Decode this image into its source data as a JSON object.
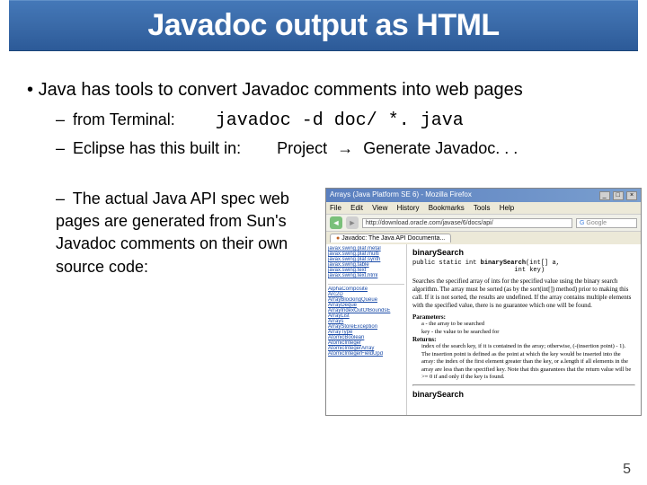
{
  "title": "Javadoc output as HTML",
  "bullet": "Java has tools to convert Javadoc comments into web pages",
  "sub1_label": "from Terminal:",
  "sub1_cmd": "javadoc -d doc/ *. java",
  "sub2_label": "Eclipse has this built in:",
  "sub2_menu1": "Project",
  "sub2_menu2": "Generate Javadoc. . .",
  "sub3_text": "The actual Java API spec web pages are generated from Sun's Javadoc comments on their own source code:",
  "page_num": "5",
  "browser": {
    "window_title": "Arrays (Java Platform SE 6) - Mozilla Firefox",
    "menu": [
      "File",
      "Edit",
      "View",
      "History",
      "Bookmarks",
      "Tools",
      "Help"
    ],
    "url": "http://download.oracle.com/javase/6/docs/api/",
    "search_placeholder": "Google",
    "tab": "Javadoc: The Java API Documenta...",
    "side_top": [
      "javax.swing.plaf.metal",
      "javax.swing.plaf.multi",
      "javax.swing.plaf.synth",
      "javax.swing.table",
      "javax.swing.text",
      "javax.swing.text.html"
    ],
    "side_bot": [
      "AlphaComposite",
      "Arc2D",
      "ArrayBlockingQueue",
      "ArrayDeque",
      "ArrayIndexOutOfBoundsE",
      "ArrayList",
      "Arrays",
      "ArrayStoreException",
      "ArrayType",
      "AtomicBoolean",
      "AtomicInteger",
      "AtomicIntegerArray",
      "AtomicIntegerFieldUpd"
    ],
    "main": {
      "heading": "binarySearch",
      "signature_pre": "public static int ",
      "signature_bold": "binarySearch",
      "signature_post": "(int[] a,",
      "signature_line2": "int key)",
      "desc": "Searches the specified array of ints for the specified value using the binary search algorithm. The array must be sorted (as by the sort(int[]) method) prior to making this call. If it is not sorted, the results are undefined. If the array contains multiple elements with the specified value, there is no guarantee which one will be found.",
      "params_label": "Parameters:",
      "param_a": "a - the array to be searched",
      "param_key": "key - the value to be searched for",
      "returns_label": "Returns:",
      "returns_text": "index of the search key, if it is contained in the array; otherwise, (-(insertion point) - 1). The insertion point is defined as the point at which the key would be inserted into the array: the index of the first element greater than the key, or a.length if all elements in the array are less than the specified key. Note that this guarantees that the return value will be >= 0 if and only if the key is found.",
      "next_heading": "binarySearch"
    }
  }
}
